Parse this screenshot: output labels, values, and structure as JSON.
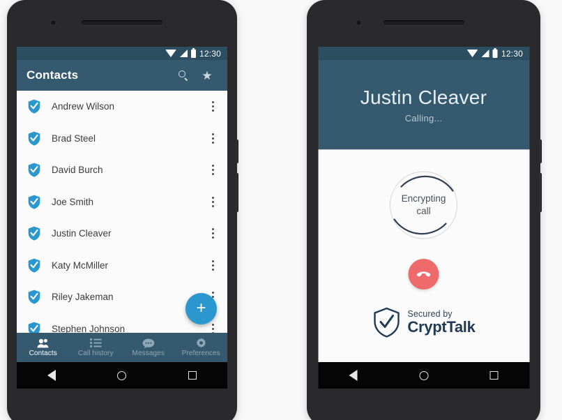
{
  "colors": {
    "toolbar": "#355a70",
    "statusbar": "#2c4e61",
    "accent_blue": "#2b97cf",
    "hangup_red": "#ef6b6b",
    "brand_navy": "#1f3b54",
    "screen_bg": "#fbfbfb"
  },
  "phone_left": {
    "statusbar": {
      "time": "12:30",
      "icons": [
        "wifi-icon",
        "signal-icon",
        "battery-icon"
      ]
    },
    "toolbar": {
      "title": "Contacts",
      "search_icon": "search-icon",
      "favorites_icon": "star-icon"
    },
    "contacts": [
      {
        "name": "Andrew Wilson",
        "secure_icon": "shield-check-icon",
        "overflow_icon": "kebab-menu-icon"
      },
      {
        "name": "Brad Steel",
        "secure_icon": "shield-check-icon",
        "overflow_icon": "kebab-menu-icon"
      },
      {
        "name": "David Burch",
        "secure_icon": "shield-check-icon",
        "overflow_icon": "kebab-menu-icon"
      },
      {
        "name": "Joe Smith",
        "secure_icon": "shield-check-icon",
        "overflow_icon": "kebab-menu-icon"
      },
      {
        "name": "Justin Cleaver",
        "secure_icon": "shield-check-icon",
        "overflow_icon": "kebab-menu-icon"
      },
      {
        "name": "Katy McMiller",
        "secure_icon": "shield-check-icon",
        "overflow_icon": "kebab-menu-icon"
      },
      {
        "name": "Riley Jakeman",
        "secure_icon": "shield-check-icon",
        "overflow_icon": "kebab-menu-icon"
      },
      {
        "name": "Stephen Johnson",
        "secure_icon": "shield-check-icon",
        "overflow_icon": "kebab-menu-icon"
      }
    ],
    "fab": {
      "label": "+",
      "icon": "plus-icon"
    },
    "bottom_nav": [
      {
        "label": "Contacts",
        "icon": "people-icon",
        "active": true
      },
      {
        "label": "Call history",
        "icon": "list-icon",
        "active": false
      },
      {
        "label": "Messages",
        "icon": "chat-bubble-icon",
        "active": false
      },
      {
        "label": "Preferences",
        "icon": "gear-icon",
        "active": false
      }
    ],
    "soft_nav": [
      "back-icon",
      "home-icon",
      "recents-icon"
    ]
  },
  "phone_right": {
    "statusbar": {
      "time": "12:30",
      "icons": [
        "wifi-icon",
        "signal-icon",
        "battery-icon"
      ]
    },
    "call": {
      "callee_name": "Justin Cleaver",
      "status": "Calling...",
      "spinner_line1": "Encrypting",
      "spinner_line2": "call",
      "hangup_icon": "hangup-phone-icon"
    },
    "brand": {
      "tagline": "Secured by",
      "name": "CryptTalk",
      "icon": "shield-check-outline-icon"
    },
    "soft_nav": [
      "back-icon",
      "home-icon",
      "recents-icon"
    ]
  }
}
